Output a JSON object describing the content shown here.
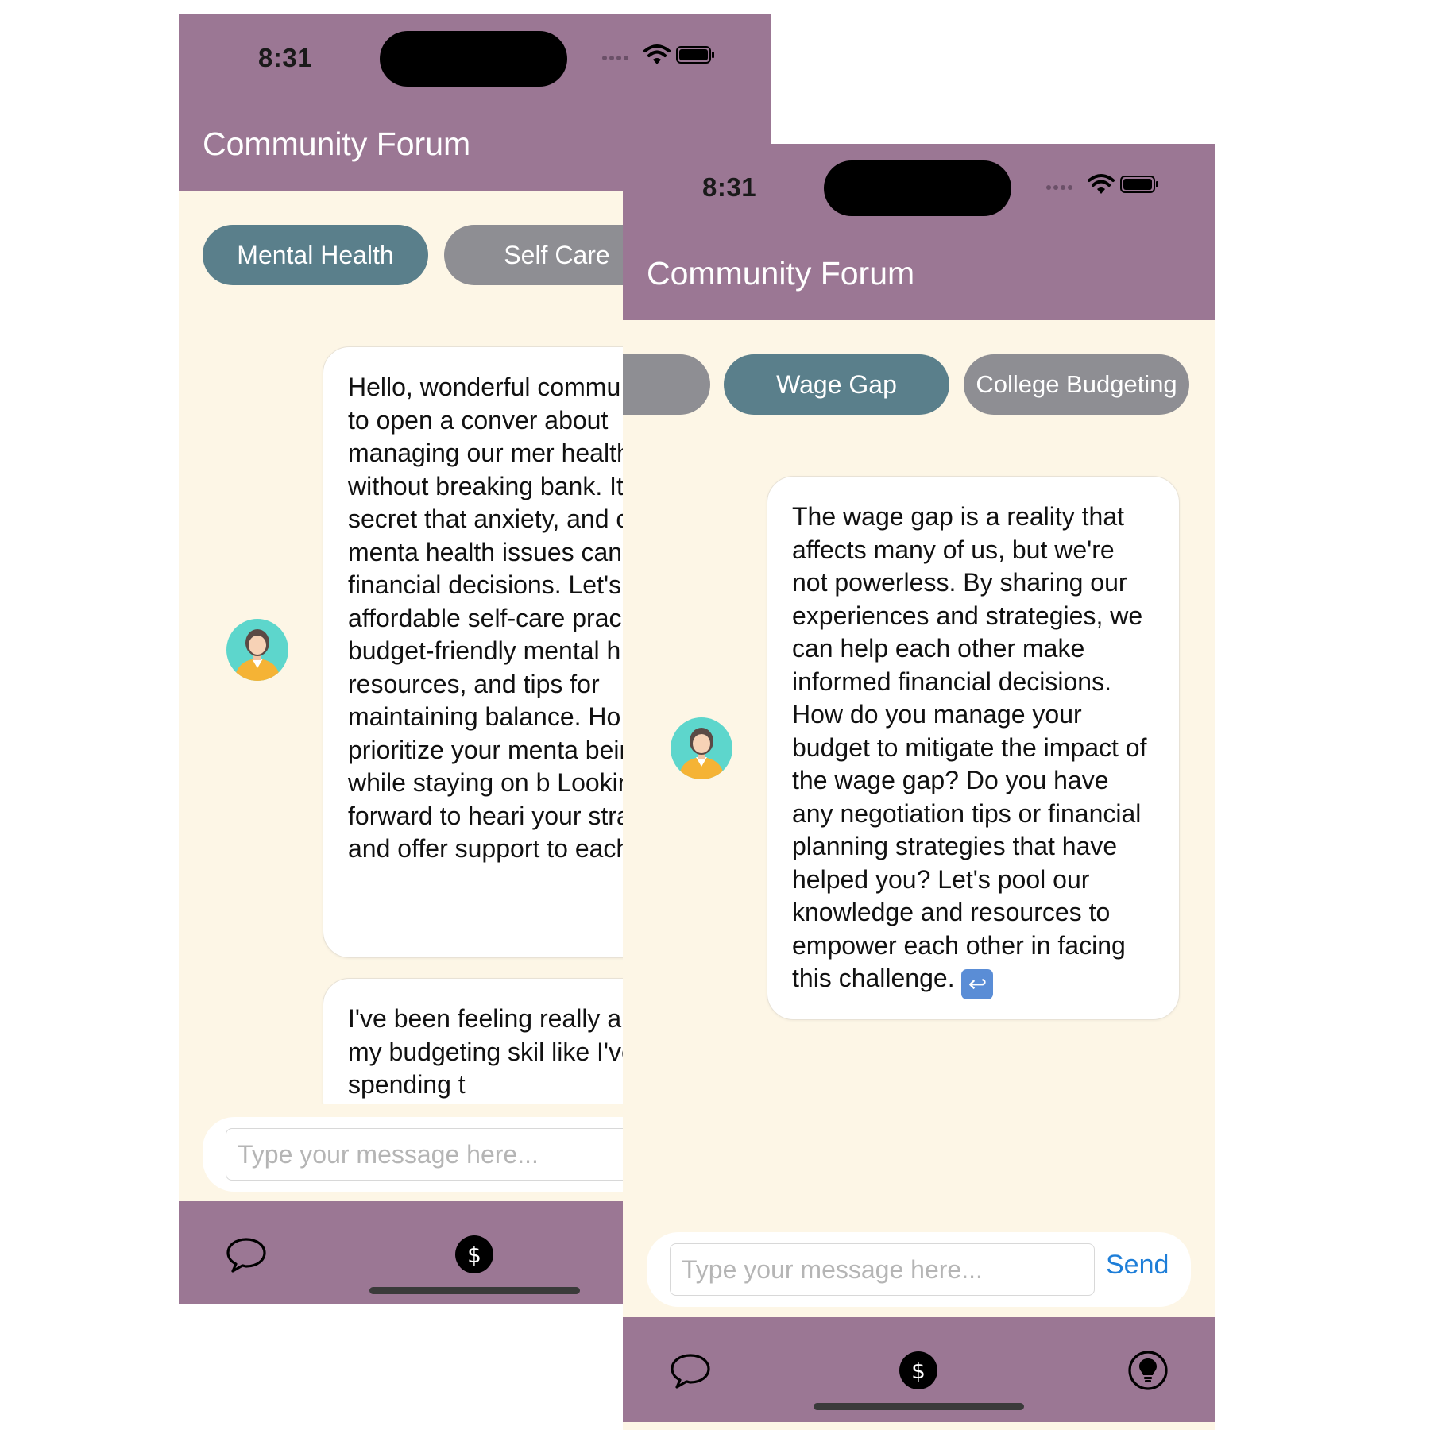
{
  "status_bar": {
    "time": "8:31"
  },
  "header": {
    "title": "Community Forum"
  },
  "screen_a": {
    "chips": [
      {
        "label": "Mental Health",
        "active": true
      },
      {
        "label": "Self Care",
        "active": false
      }
    ],
    "messages": [
      {
        "text": "Hello, wonderful commu wanted to open a conver about managing our mer health without breaking bank. It's no secret that anxiety, and other menta health issues can affect financial decisions. Let's affordable self-care prac budget-friendly mental h resources, and tips for maintaining balance. Ho you prioritize your menta being while staying on b Looking forward to heari your strategies and offer support to each other!"
      },
      {
        "text": "I've been feeling really a about my budgeting skil like I've been spending t"
      }
    ],
    "input": {
      "placeholder": "Type your message here..."
    }
  },
  "screen_b": {
    "chips": [
      {
        "label": "",
        "active": false
      },
      {
        "label": "Wage Gap",
        "active": true
      },
      {
        "label": "College Budgeting",
        "active": false
      }
    ],
    "messages": [
      {
        "text": "The wage gap is a reality that affects many of us, but we're not powerless. By sharing our experiences and strategies, we can help each other make informed financial decisions. How do you manage your budget to mitigate the impact of the wage gap? Do you have any negotiation tips or financial planning strategies that have helped you? Let's pool our knowledge and resources to empower each other in facing this challenge."
      }
    ],
    "input": {
      "placeholder": "Type your message here...",
      "send_label": "Send"
    }
  },
  "tabbar": {
    "tabs": [
      {
        "icon": "chat-bubble-icon"
      },
      {
        "icon": "dollar-circle-icon",
        "glyph": "$"
      },
      {
        "icon": "lightbulb-circle-icon"
      }
    ]
  },
  "colors": {
    "header": "#9b7794",
    "background": "#fdf6e6",
    "chip_active": "#5a7f8b",
    "chip_inactive": "#8e8e93",
    "send": "#1e7ed8"
  }
}
